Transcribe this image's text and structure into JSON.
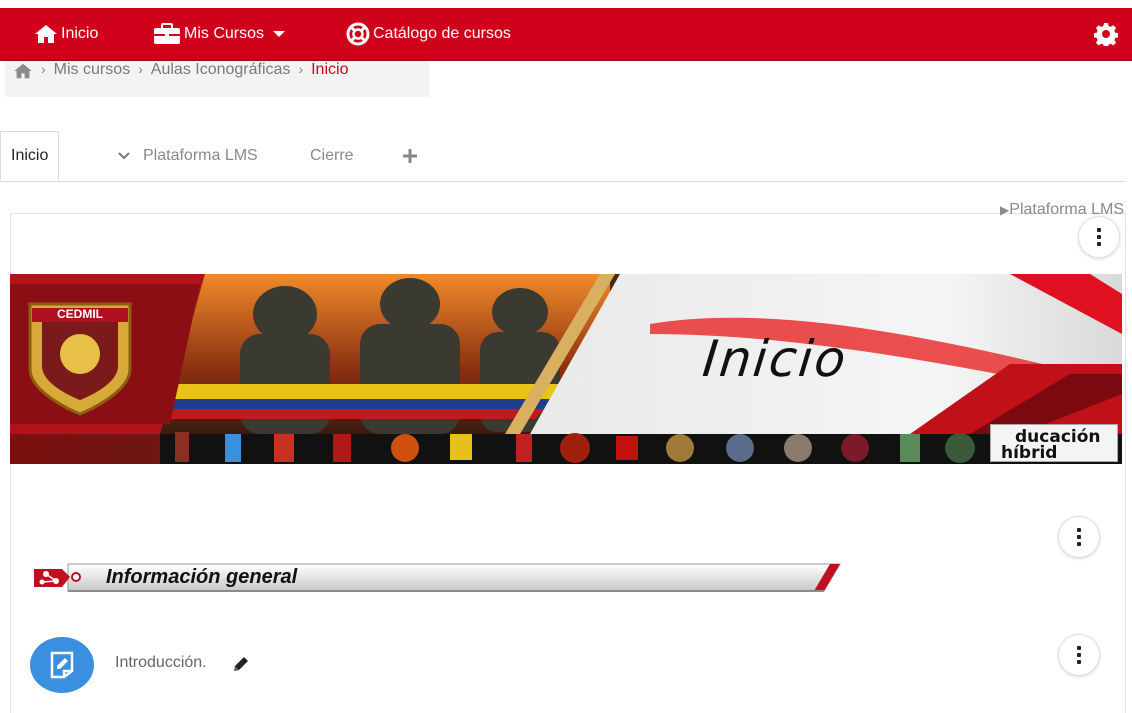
{
  "navbar": {
    "items": [
      {
        "label": "Inicio",
        "icon": "home-icon"
      },
      {
        "label": "Mis Cursos",
        "icon": "briefcase-icon",
        "dropdown": true
      },
      {
        "label": "Catálogo de cursos",
        "icon": "life-ring-icon"
      }
    ],
    "settings_icon": "gear-icon",
    "color": "#d0021b"
  },
  "breadcrumb": {
    "items": [
      "Mis cursos",
      "Aulas Iconográficas",
      "Inicio"
    ],
    "active_color": "#d0021b"
  },
  "tabs": [
    {
      "label": "Inicio",
      "active": true
    },
    {
      "label": "Plataforma LMS",
      "collapsible": true
    },
    {
      "label": "Cierre"
    }
  ],
  "section_link": "Plataforma LMS",
  "banner": {
    "logo_text": "CEDMIL",
    "title": "Inicio",
    "edu_logo_line1": "ducación",
    "edu_logo_line2": "híbrid"
  },
  "section": {
    "title": "Información general"
  },
  "activity": {
    "label": "Introducción.",
    "icon": "page-icon",
    "icon_color": "#3a8fde"
  }
}
